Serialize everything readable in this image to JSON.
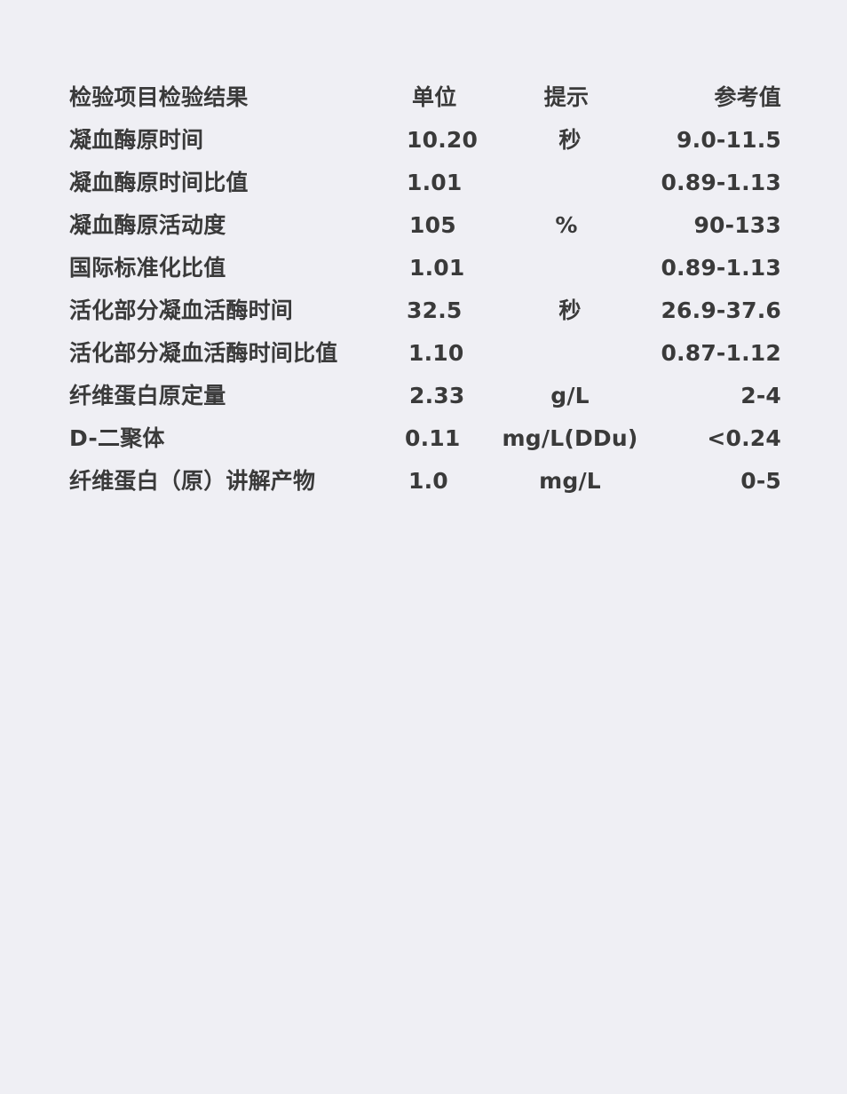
{
  "header": {
    "name": "检验项目检验结果",
    "result": "单位",
    "unit": "提示",
    "reference": "参考值"
  },
  "rows": [
    {
      "name": "凝血酶原时间",
      "result": "10.20",
      "unit": "秒",
      "reference": "9.0-11.5"
    },
    {
      "name": "凝血酶原时间比值",
      "result": "1.01",
      "unit": "",
      "reference": "0.89-1.13"
    },
    {
      "name": "凝血酶原活动度",
      "result": "105",
      "unit": "%",
      "reference": "90-133"
    },
    {
      "name": "国际标准化比值",
      "result": "1.01",
      "unit": "",
      "reference": "0.89-1.13"
    },
    {
      "name": "活化部分凝血活酶时间",
      "result": "32.5",
      "unit": "秒",
      "reference": "26.9-37.6"
    },
    {
      "name": "活化部分凝血活酶时间比值",
      "result": "1.10",
      "unit": "",
      "reference": "0.87-1.12"
    },
    {
      "name": "纤维蛋白原定量",
      "result": "2.33",
      "unit": "g/L",
      "reference": "2-4"
    },
    {
      "name": "D-二聚体",
      "result": "0.11",
      "unit": "mg/L(DDu)",
      "reference": "<0.24"
    },
    {
      "name": "纤维蛋白（原）讲解产物",
      "result": "1.0",
      "unit": "mg/L",
      "reference": "0-5"
    }
  ]
}
